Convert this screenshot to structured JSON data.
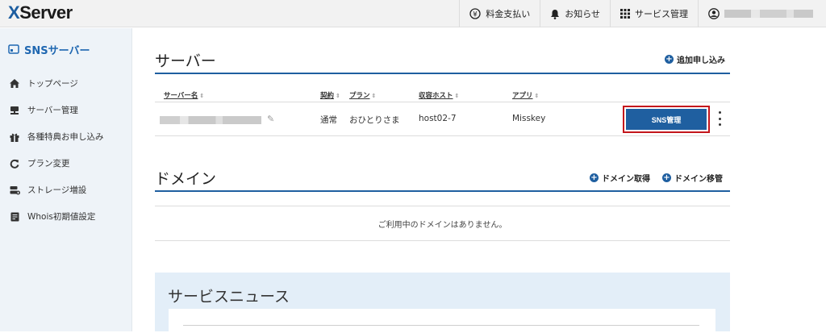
{
  "header": {
    "logo_x": "X",
    "logo_rest": "Server",
    "nav": [
      {
        "icon": "yen-icon",
        "label": "料金支払い"
      },
      {
        "icon": "bell-icon",
        "label": "お知らせ"
      },
      {
        "icon": "grid-icon",
        "label": "サービス管理"
      },
      {
        "icon": "user-icon",
        "label": ""
      }
    ]
  },
  "sidebar": {
    "title": "SNSサーバー",
    "items": [
      {
        "icon": "home-icon",
        "label": "トップページ"
      },
      {
        "icon": "server-icon",
        "label": "サーバー管理"
      },
      {
        "icon": "gift-icon",
        "label": "各種特典お申し込み"
      },
      {
        "icon": "refresh-icon",
        "label": "プラン変更"
      },
      {
        "icon": "storage-icon",
        "label": "ストレージ増設"
      },
      {
        "icon": "document-icon",
        "label": "Whois初期値設定"
      }
    ]
  },
  "servers": {
    "title": "サーバー",
    "add_link": "追加申し込み",
    "columns": [
      "サーバー名",
      "契約",
      "プラン",
      "収容ホスト",
      "アプリ"
    ],
    "rows": [
      {
        "name": "",
        "contract": "通常",
        "plan": "おひとりさま",
        "host": "host02-7",
        "app": "Misskey",
        "action": "SNS管理"
      }
    ]
  },
  "domains": {
    "title": "ドメイン",
    "acquire_link": "ドメイン取得",
    "transfer_link": "ドメイン移管",
    "empty_message": "ご利用中のドメインはありません。"
  },
  "news": {
    "title": "サービスニュース"
  },
  "colors": {
    "accent": "#1f5fa0",
    "highlight_border": "#c4161c",
    "sidebar_bg": "#eef3f8"
  }
}
